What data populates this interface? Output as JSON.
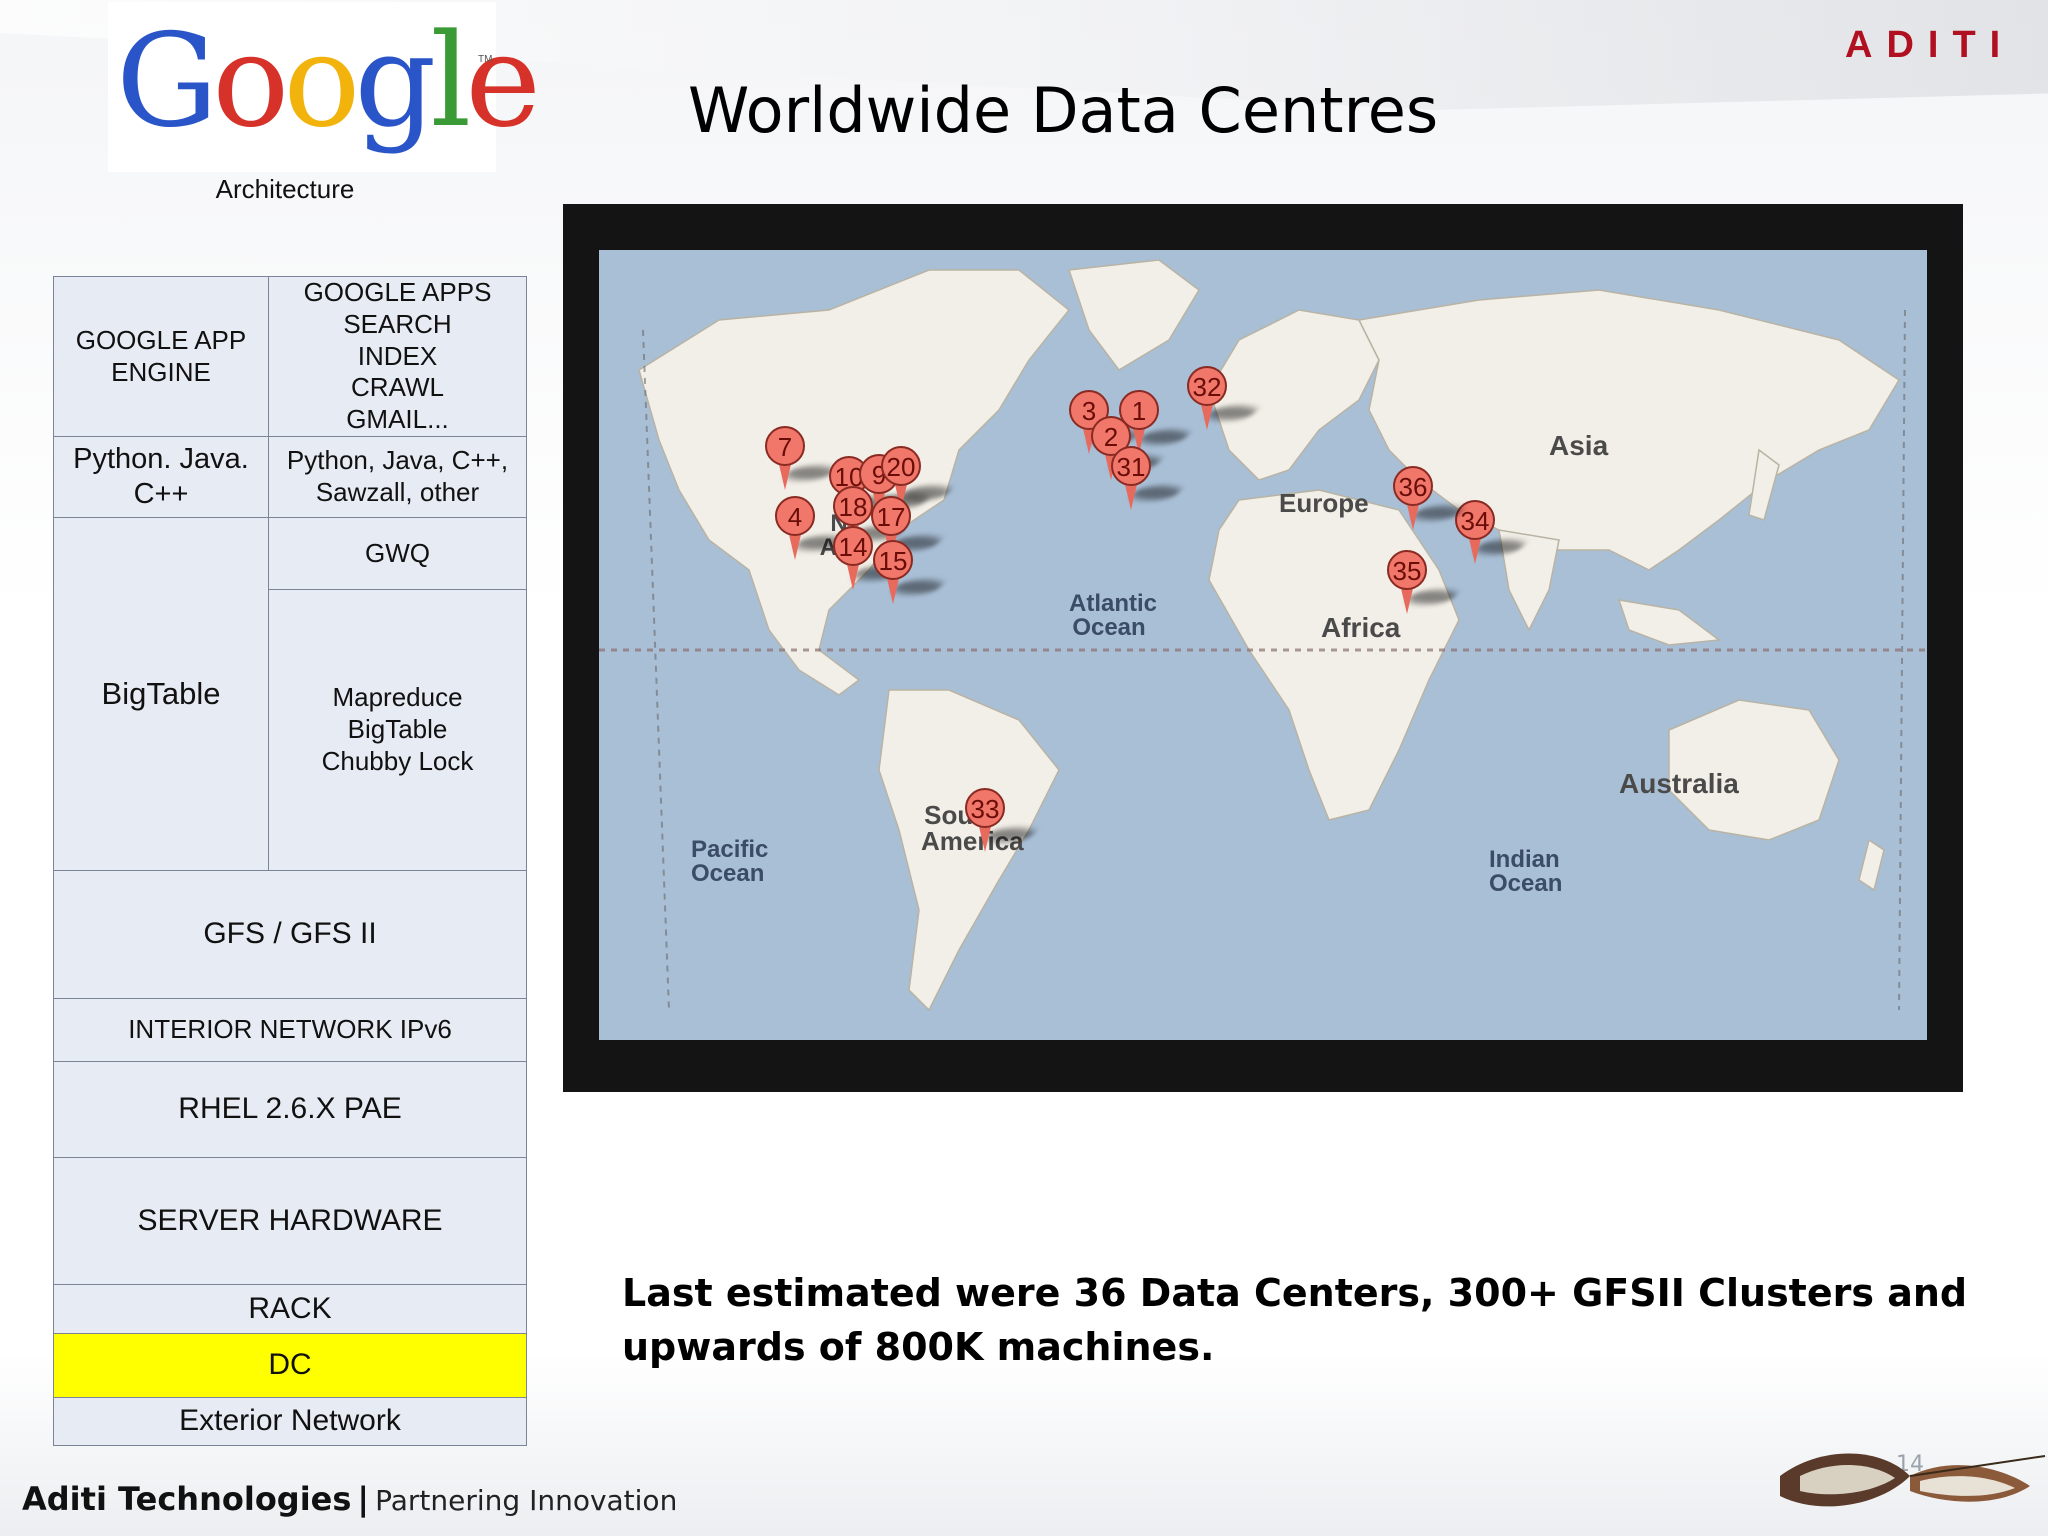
{
  "header": {
    "logo_text": "Google",
    "logo_tm": "TM",
    "logo_caption": "Architecture",
    "title": "Worldwide Data Centres",
    "brand": "ADITI"
  },
  "stack": {
    "app_engine": "GOOGLE APP ENGINE",
    "apps": [
      "GOOGLE APPS",
      "SEARCH",
      "INDEX",
      "CRAWL",
      "GMAIL..."
    ],
    "languages_left": "Python. Java. C++",
    "languages_right": "Python, Java, C++, Sawzall, other",
    "bigtable": "BigTable",
    "gwq": "GWQ",
    "services": [
      "Mapreduce",
      "BigTable",
      "Chubby Lock"
    ],
    "gfs": "GFS / GFS II",
    "interior_network": "INTERIOR NETWORK IPv6",
    "rhel": "RHEL 2.6.X PAE",
    "server_hardware": "SERVER HARDWARE",
    "rack": "RACK",
    "dc": "DC",
    "exterior_network": "Exterior Network",
    "highlight_color": "#ffff00",
    "cell_color": "#e7ebf4"
  },
  "map": {
    "labels": {
      "asia": "Asia",
      "europe": "Europe",
      "africa": "Africa",
      "south_america": "South America",
      "australia": "Australia",
      "north_america": "N Am",
      "atlantic": "Atlantic Ocean",
      "pacific": "Pacific Ocean",
      "indian": "Indian Ocean"
    },
    "pins": [
      "7",
      "4",
      "10",
      "9",
      "20",
      "18",
      "17",
      "14",
      "15",
      "3",
      "2",
      "1",
      "31",
      "32",
      "33",
      "34",
      "35",
      "36"
    ],
    "pin_color": "#f0776a",
    "ocean_color": "#a9bfd6",
    "land_color": "#f2efe8"
  },
  "note": "Last estimated were 36 Data Centers, 300+ GFSII Clusters and upwards of 800K machines.",
  "footer": {
    "company": "Aditi Technologies",
    "separator": "|",
    "tagline": "Partnering Innovation",
    "slide_number": "14"
  }
}
